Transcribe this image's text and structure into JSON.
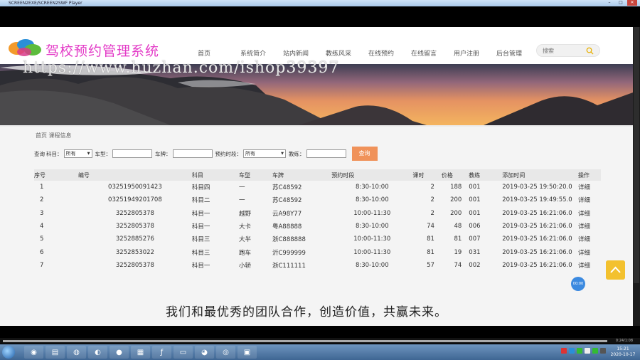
{
  "player": {
    "title": "SCREEN2EXE/SCREEN2SWF Player",
    "controls": [
      "–",
      "□",
      "✕"
    ]
  },
  "site": {
    "title": "驾校预约管理系统",
    "nav": [
      "首页",
      "系统简介",
      "站内新闻",
      "教练风采",
      "在线预约",
      "在线留言",
      "用户注册",
      "后台管理"
    ],
    "search_placeholder": "搜索",
    "watermark": "https://www.huzhan.com/ishop39397"
  },
  "breadcrumb": "首页  课程信息",
  "filters": {
    "query_label": "查询",
    "subject_label": "科目：",
    "subject_value": "所有",
    "car_type_label": "车型：",
    "plate_label": "车牌：",
    "time_label": "预约时段：",
    "time_value": "所有",
    "coach_label": "教练：",
    "query_button": "查询"
  },
  "table": {
    "headers": [
      "序号",
      "编号",
      "科目",
      "车型",
      "车牌",
      "预约时段",
      "课时",
      "价格",
      "教练",
      "添加时间",
      "操作"
    ],
    "rows": [
      [
        "1",
        "03251950091423",
        "科目四",
        "一",
        "苏C48592",
        "8:30-10:00",
        "2",
        "188",
        "001",
        "2019-03-25 19:50:20.0",
        "详细"
      ],
      [
        "2",
        "03251949201708",
        "科目二",
        "一",
        "苏C48592",
        "8:30-10:00",
        "2",
        "200",
        "001",
        "2019-03-25 19:49:55.0",
        "详细"
      ],
      [
        "3",
        "3252805378",
        "科目一",
        "越野",
        "云A98Y77",
        "10:00-11:30",
        "2",
        "200",
        "001",
        "2019-03-25 16:21:06.0",
        "详细"
      ],
      [
        "4",
        "3252805378",
        "科目一",
        "大卡",
        "粤A88888",
        "8:30-10:00",
        "74",
        "48",
        "006",
        "2019-03-25 16:21:06.0",
        "详细"
      ],
      [
        "5",
        "3252885276",
        "科目三",
        "大半",
        "浙C888888",
        "10:00-11:30",
        "81",
        "81",
        "007",
        "2019-03-25 16:21:06.0",
        "详细"
      ],
      [
        "6",
        "3252853022",
        "科目三",
        "跑车",
        "沂C999999",
        "10:00-11:30",
        "81",
        "19",
        "031",
        "2019-03-25 16:21:06.0",
        "详细"
      ],
      [
        "7",
        "3252805378",
        "科目一",
        "小轿",
        "浙C111111",
        "8:30-10:00",
        "57",
        "74",
        "002",
        "2019-03-25 16:21:06.0",
        "详细"
      ]
    ]
  },
  "slogan": "我们和最优秀的团队合作，创造价值，共赢未来。",
  "chat_bubble": "00:00",
  "timeline_time": "0:24/1:08",
  "clock": {
    "time": "15:21",
    "date": "2020-10-17"
  },
  "colors": {
    "brand_pink": "#e33bc7",
    "query_button": "#f0925a",
    "scroll_top": "#f3c12e",
    "active_dot": "#f0c200"
  }
}
